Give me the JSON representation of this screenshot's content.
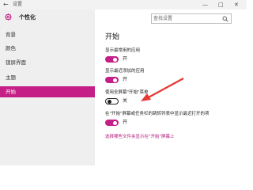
{
  "titlebar": {
    "back_glyph": "←",
    "title": "设置",
    "minimize_glyph": "—",
    "maximize_glyph": "□",
    "close_glyph": "✕"
  },
  "sidebar": {
    "header": "个性化",
    "items": [
      {
        "label": "背景",
        "active": false
      },
      {
        "label": "颜色",
        "active": false
      },
      {
        "label": "锁屏界面",
        "active": false
      },
      {
        "label": "主题",
        "active": false
      },
      {
        "label": "开始",
        "active": true
      }
    ]
  },
  "search": {
    "placeholder": "查找设置"
  },
  "main": {
    "title": "开始",
    "settings": [
      {
        "label": "显示最常用的应用",
        "state": "开",
        "on": true
      },
      {
        "label": "显示最近添加的应用",
        "state": "开",
        "on": true
      },
      {
        "label": "使用全屏幕\"开始\"菜单",
        "state": "关",
        "on": false
      },
      {
        "label": "在\"开始\"屏幕或任务栏的跳转列表中显示最近打开的项",
        "state": "开",
        "on": true
      }
    ],
    "link": "选择哪些文件夹显示在\"开始\"屏幕上"
  },
  "colors": {
    "accent": "#c51f87",
    "annotation_arrow": "#e53935"
  },
  "icons": {
    "header": "gear-icon",
    "search": "search-icon",
    "back": "back-arrow-icon"
  }
}
